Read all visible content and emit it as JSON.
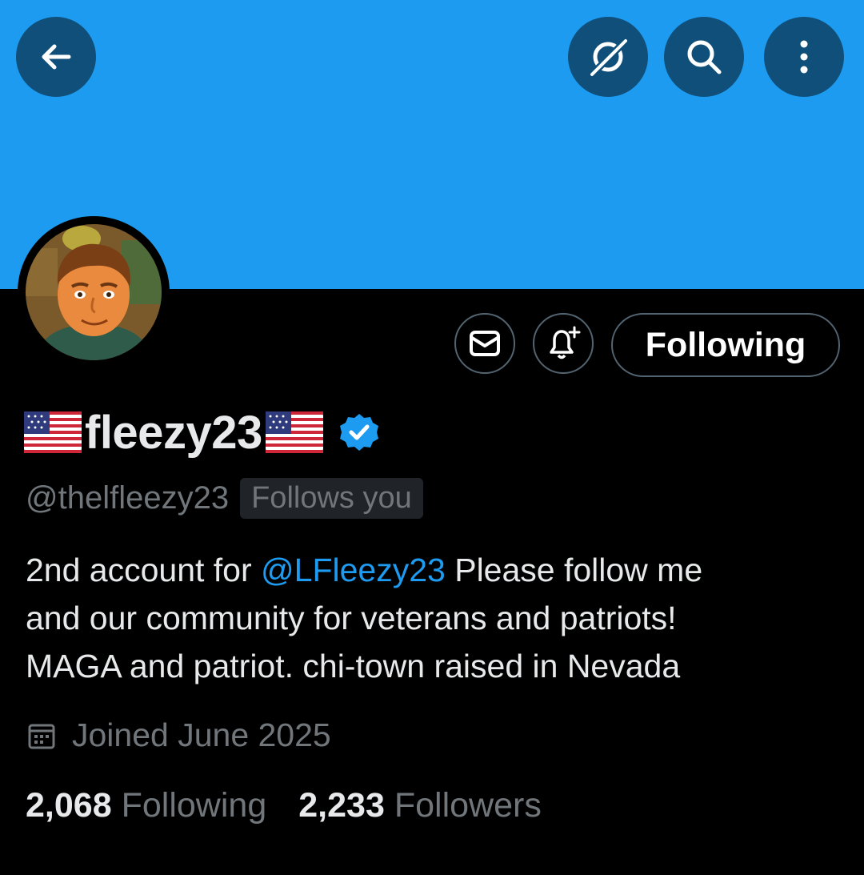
{
  "banner": {
    "color": "#1d9bf0"
  },
  "top_bar": {
    "back_icon": "arrow-left-icon",
    "grok_icon": "grok-icon",
    "search_icon": "search-icon",
    "more_icon": "more-vertical-icon"
  },
  "profile": {
    "display_name": "fleezy23",
    "name_decoration": "🇺🇸",
    "verified": true,
    "handle": "@thelfleezy23",
    "follows_you_badge": "Follows you",
    "bio_prefix": "2nd account for ",
    "bio_mention": "@LFleezy23",
    "bio_line1_rest": " Please follow me",
    "bio_line2": "and our community for veterans and patriots!",
    "bio_line3": "MAGA and patriot. chi-town raised in Nevada",
    "joined": "Joined June 2025"
  },
  "actions": {
    "message_icon": "envelope-icon",
    "notify_icon": "bell-plus-icon",
    "following_label": "Following"
  },
  "stats": {
    "following_count": "2,068",
    "following_label": "Following",
    "followers_count": "2,233",
    "followers_label": "Followers"
  },
  "colors": {
    "accent": "#1d9bf0",
    "muted": "#71767b",
    "background": "#000000"
  }
}
